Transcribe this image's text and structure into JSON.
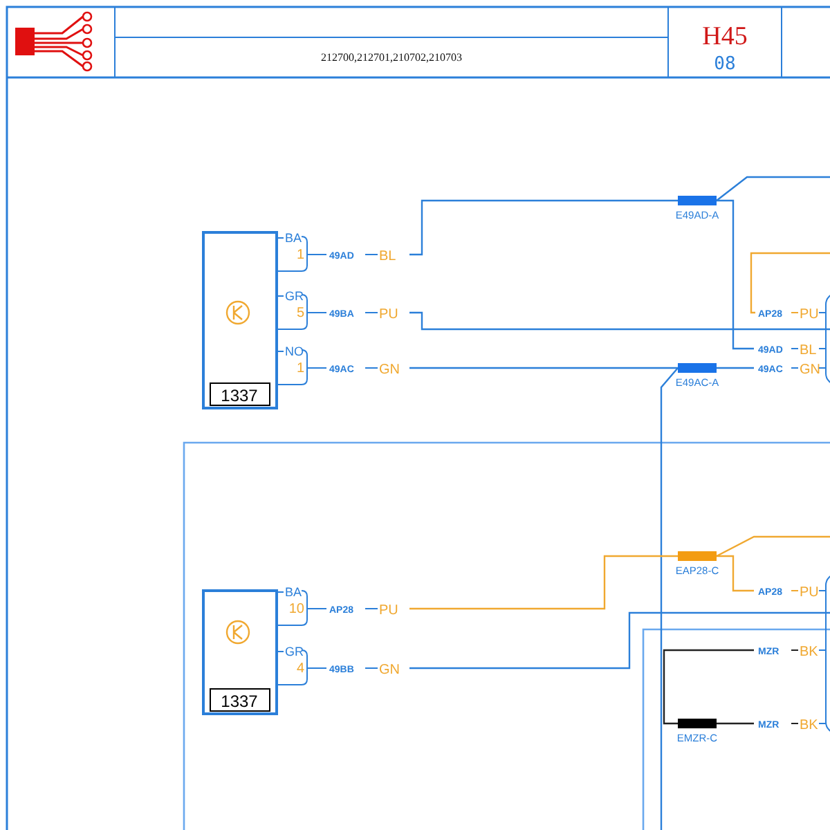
{
  "title_block": {
    "part_numbers": "212700,212701,210702,210703",
    "diagram_code": "H45",
    "sheet": "08"
  },
  "components": [
    {
      "ref": "1337",
      "pins": [
        {
          "cavity_label": "BA",
          "pin": "1",
          "wire": "49AD",
          "color_code": "BL"
        },
        {
          "cavity_label": "GR",
          "pin": "5",
          "wire": "49BA",
          "color_code": "PU"
        },
        {
          "cavity_label": "NO",
          "pin": "1",
          "wire": "49AC",
          "color_code": "GN"
        }
      ]
    },
    {
      "ref": "1337",
      "pins": [
        {
          "cavity_label": "BA",
          "pin": "10",
          "wire": "AP28",
          "color_code": "PU"
        },
        {
          "cavity_label": "GR",
          "pin": "4",
          "wire": "49BB",
          "color_code": "GN"
        }
      ]
    }
  ],
  "splices": [
    {
      "label": "E49AD-A",
      "color": "#1a73e8"
    },
    {
      "label": "E49AC-A",
      "color": "#1a73e8"
    },
    {
      "label": "EAP28-C",
      "color": "#f39c12"
    },
    {
      "label": "EMZR-C",
      "color": "#000000"
    }
  ],
  "right_terminals": [
    {
      "wire": "AP28",
      "color_code": "PU"
    },
    {
      "wire": "49AD",
      "color_code": "BL"
    },
    {
      "wire": "49AC",
      "color_code": "GN"
    },
    {
      "wire": "AP28",
      "color_code": "PU"
    },
    {
      "wire": "MZR",
      "color_code": "BK"
    },
    {
      "wire": "MZR",
      "color_code": "BK"
    }
  ]
}
